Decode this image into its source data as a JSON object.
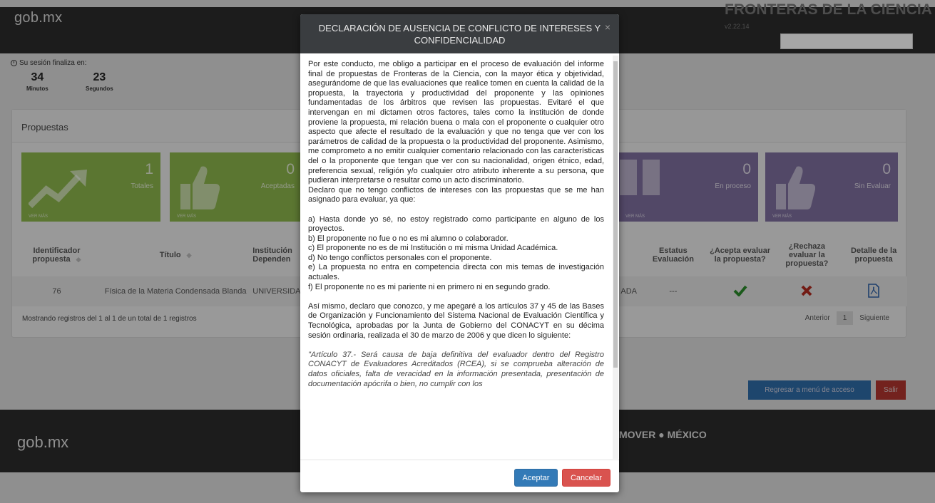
{
  "header": {
    "logo": "gob.mx",
    "app_title": "FRONTERAS DE LA CIENCIA",
    "version": "v2.22.14"
  },
  "session": {
    "label": "Su sesión finaliza en:",
    "minutes": "34",
    "minutes_unit": "Minutos",
    "seconds": "23",
    "seconds_unit": "Segundos"
  },
  "panel": {
    "title": "Propuestas",
    "tiles": [
      {
        "count": "1",
        "label": "Totales",
        "more": "VER MÁS",
        "color": "#8cb54c",
        "icon": "trend-up-icon"
      },
      {
        "count": "0",
        "label": "Aceptadas",
        "more": "VER MÁS",
        "color": "#8cb54c",
        "icon": "thumbs-up-icon"
      },
      {
        "count": "0",
        "label": "En proceso",
        "more": "VER MÁS",
        "color": "#7f6f9e",
        "icon": "binoculars-icon"
      },
      {
        "count": "0",
        "label": "Sin Evaluar",
        "more": "VER MÁS",
        "color": "#7f6f9e",
        "icon": "thumbs-up-icon"
      }
    ],
    "columns": [
      "Identificador propuesta",
      "Título",
      "Institución Dependen",
      "Estatus Evaluación",
      "¿Acepta evaluar la propuesta?",
      "¿Rechaza evaluar la propuesta?",
      "Detalle de la propuesta"
    ],
    "row": {
      "id": "76",
      "title": "Física de la Materia Condensada Blanda",
      "institution": "UNIVERSIDA",
      "status_partial": "ADA",
      "status": "---"
    },
    "showing": "Mostrando registros del 1 al 1 de un total de 1 registros",
    "pager": {
      "prev": "Anterior",
      "page": "1",
      "next": "Siguiente"
    }
  },
  "actions": {
    "back": "Regresar a menú de acceso",
    "exit": "Salir"
  },
  "footer": {
    "logo": "gob.mx",
    "slogan": "MOVER ● MÉXICO"
  },
  "modal": {
    "title": "DECLARACIÓN DE AUSENCIA DE CONFLICTO DE INTERESES Y CONFIDENCIALIDAD",
    "para1": "Por este conducto, me obligo a participar en el proceso de evaluación del informe final de propuestas de Fronteras de la Ciencia, con la mayor ética y objetividad, asegurándome de que las evaluaciones que realice tomen en cuenta la calidad de la propuesta, la trayectoria y productividad del proponente y las opiniones fundamentadas de los árbitros que revisen las propuestas. Evitaré el que intervengan en mi dictamen otros factores, tales como la institución de donde proviene la propuesta, mi relación buena o mala con el proponente o cualquier otro aspecto que afecte el resultado de la evaluación y que no tenga que ver con los parámetros de calidad de la propuesta o la productividad del proponente. Asimismo, me comprometo a no emitir cualquier comentario relacionado con las características del o la proponente que tengan que ver con su nacionalidad, origen étnico, edad, preferencia sexual, religión y/o cualquier otro atributo inherente a su persona, que pudieran interpretarse o resultar como un acto discriminatorio.",
    "para2": "Declaro que no tengo conflictos de intereses con las propuestas que se me han asignado para evaluar, ya que:",
    "items": [
      "a) Hasta donde yo sé, no estoy registrado como participante en alguno de los proyectos.",
      "b) El proponente no fue o no es mi alumno o colaborador.",
      "c) El proponente no es de mi Institución o mi misma Unidad Académica.",
      "d) No tengo conflictos personales con el proponente.",
      "e) La propuesta no entra en competencia directa con mis temas de investigación actuales.",
      "f) El proponente no es mi pariente ni en primero ni en segundo grado."
    ],
    "para3": "Así mismo, declaro que conozco, y me apegaré a los artículos 37 y 45 de las Bases de Organización y Funcionamiento del Sistema Nacional de Evaluación Científica y Tecnológica, aprobadas por la Junta de Gobierno del CONACYT en su décima sesión ordinaria, realizada el 30 de marzo de 2006 y que dicen lo siguiente:",
    "quote": "\"Artículo 37.- Será causa de baja definitiva del evaluador dentro del Registro CONACYT de Evaluadores Acreditados (RCEA), si se comprueba alteración de datos oficiales, falta de veracidad en la información presentada, presentación de documentación apócrifa o bien, no cumplir con los",
    "accept": "Aceptar",
    "cancel": "Cancelar"
  }
}
